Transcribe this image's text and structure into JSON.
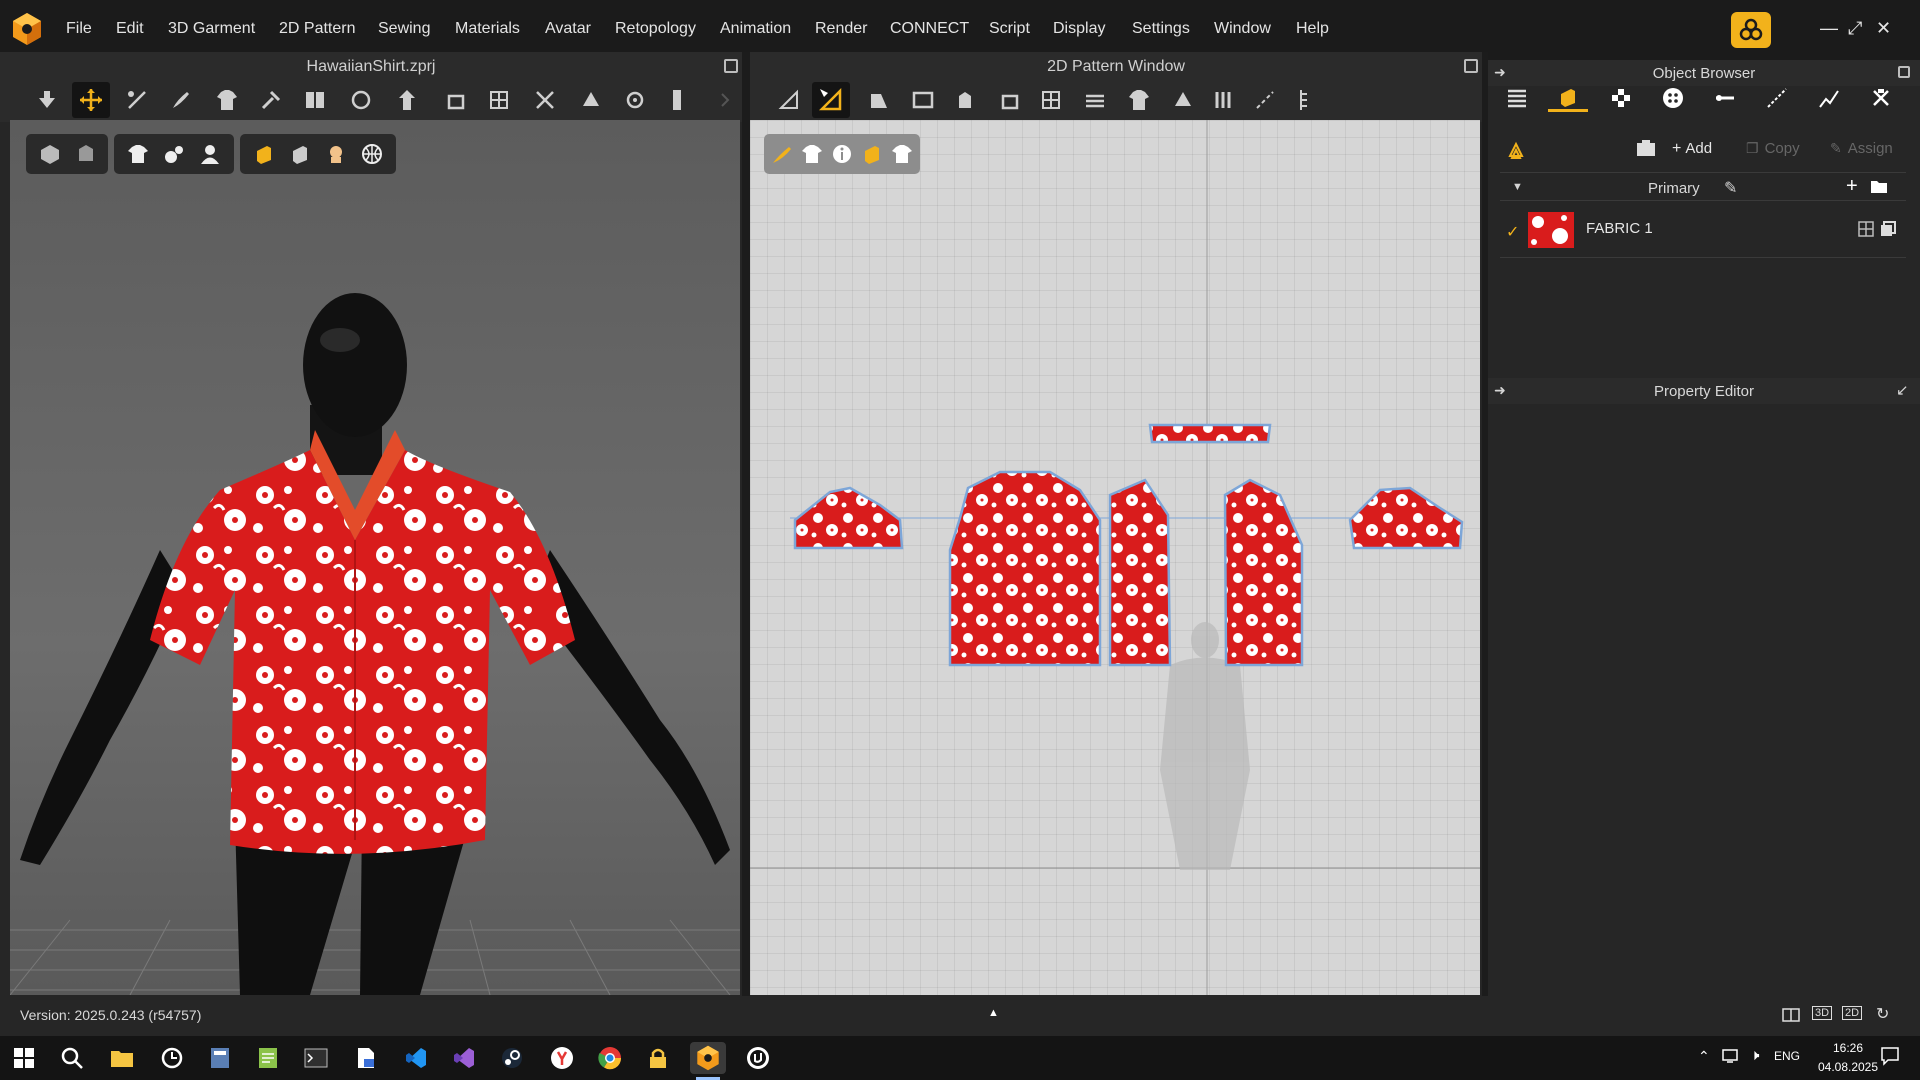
{
  "app": {
    "name": "CLO"
  },
  "menu": [
    "File",
    "Edit",
    "3D Garment",
    "2D Pattern",
    "Sewing",
    "Materials",
    "Avatar",
    "Retopology",
    "Animation",
    "Render",
    "CONNECT",
    "Script",
    "Display",
    "Settings",
    "Window",
    "Help"
  ],
  "icons": {
    "app_logo": "clo-cube-icon",
    "connect": "clo-connect-icon",
    "window_controls": [
      "minimize-icon",
      "restore-icon",
      "close-icon"
    ]
  },
  "panel3d": {
    "title": "HawaiianShirt.zprj"
  },
  "panel2d": {
    "title": "2D Pattern Window"
  },
  "object_browser": {
    "title": "Object Browser",
    "add_label": "Add",
    "copy_label": "Copy",
    "assign_label": "Assign",
    "group_label": "Primary",
    "fabric_name": "FABRIC 1"
  },
  "property_editor": {
    "title": "Property Editor"
  },
  "status": {
    "version": "Version: 2025.0.243 (r54757)"
  },
  "taskbar": {
    "lang": "ENG",
    "time": "16:26",
    "date": "04.08.2025"
  },
  "colors": {
    "accent": "#f2b21b",
    "fabric_red": "#d91c1c",
    "pattern_outline": "#7da6d8"
  }
}
